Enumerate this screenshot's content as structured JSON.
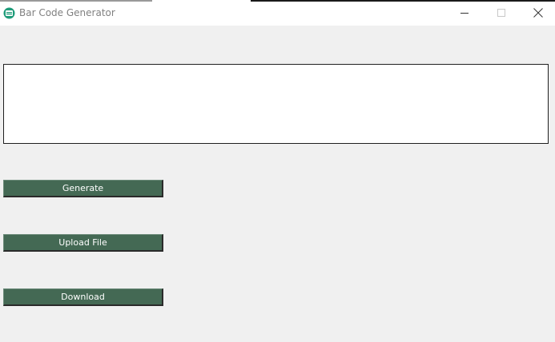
{
  "window": {
    "title": "Bar Code Generator",
    "controls": {
      "minimize": "minimize-icon",
      "maximize": "maximize-icon",
      "close": "close-icon"
    }
  },
  "input": {
    "value": ""
  },
  "buttons": {
    "generate_label": "Generate",
    "upload_label": "Upload File",
    "download_label": "Download"
  },
  "colors": {
    "button_bg": "#446954",
    "button_text": "#ffffff",
    "window_bg": "#f0f0f0",
    "app_icon": "#1f9c7a"
  }
}
